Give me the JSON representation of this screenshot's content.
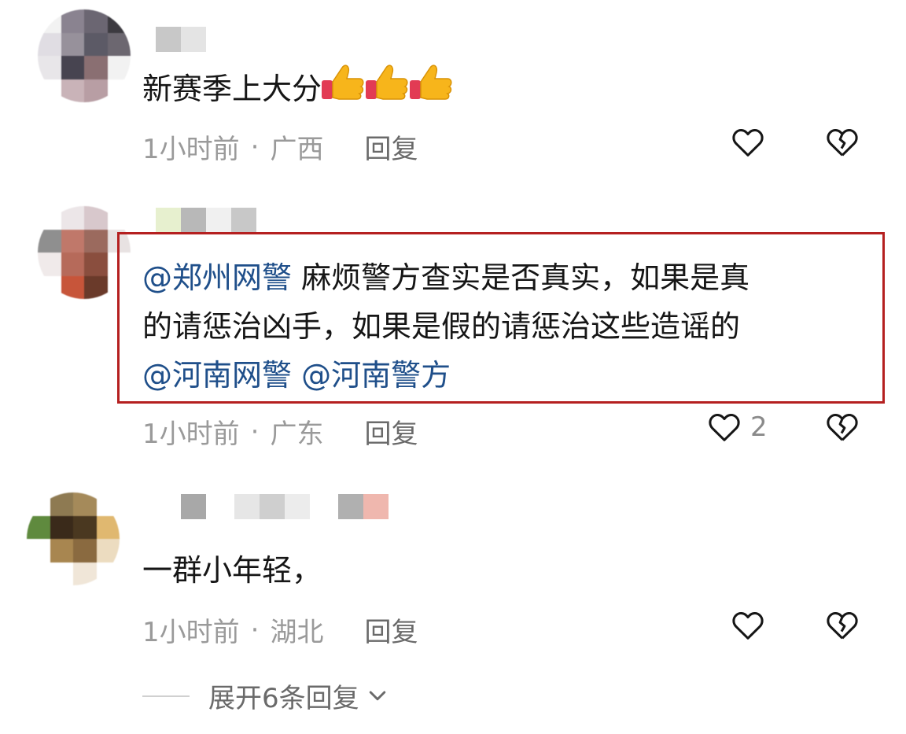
{
  "comments": [
    {
      "text": "新赛季上大分",
      "emoji": "thumbs-up-icon",
      "emoji_count": 3,
      "time": "1小时前",
      "location": "广西",
      "reply_label": "回复",
      "like_count": ""
    },
    {
      "mention1": "@郑州网警",
      "text_line1": " 麻烦警方查实是否真实，如果是真",
      "text_line2": "的请惩治凶手，如果是假的请惩治这些造谣的",
      "mention2": "@河南网警",
      "mention3": "@河南警方",
      "time": "1小时前",
      "location": "广东",
      "reply_label": "回复",
      "like_count": "2"
    },
    {
      "text": "一群小年轻，",
      "time": "1小时前",
      "location": "湖北",
      "reply_label": "回复",
      "like_count": ""
    }
  ],
  "separator": "·",
  "expand_label": "展开6条回复",
  "colors": {
    "mention": "#1f4f8a",
    "highlight_border": "#b52020",
    "meta_gray": "#9a9a9a"
  }
}
